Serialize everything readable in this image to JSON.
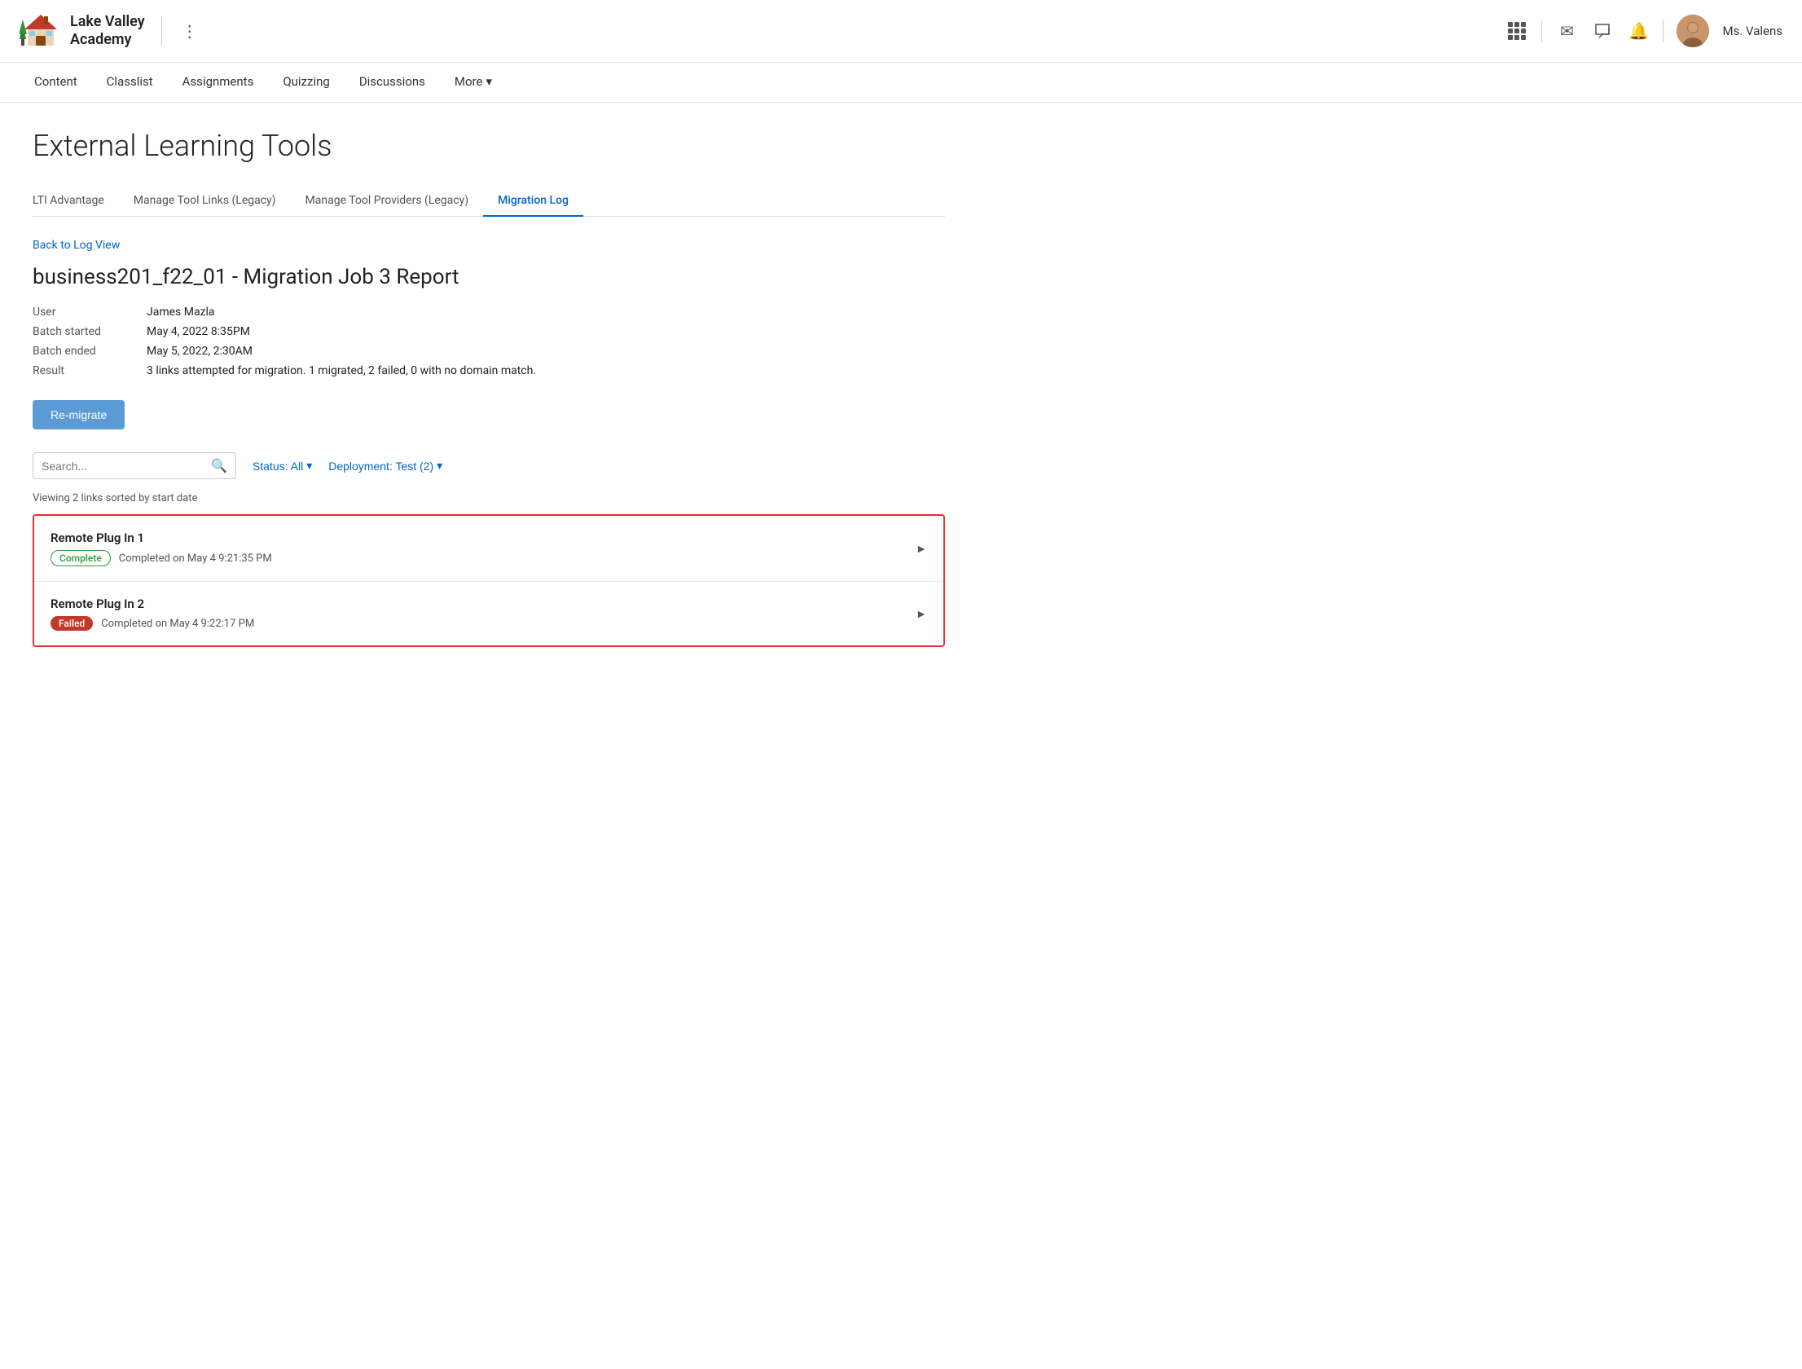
{
  "header": {
    "school_name_line1": "Lake Valley",
    "school_name_line2": "Academy",
    "user_name": "Ms. Valens",
    "icons": {
      "grid": "grid-icon",
      "mail": "✉",
      "chat": "💬",
      "bell": "🔔"
    }
  },
  "nav": {
    "items": [
      {
        "label": "Content",
        "active": false
      },
      {
        "label": "Classlist",
        "active": false
      },
      {
        "label": "Assignments",
        "active": false
      },
      {
        "label": "Quizzing",
        "active": false
      },
      {
        "label": "Discussions",
        "active": false
      },
      {
        "label": "More",
        "active": false,
        "has_dropdown": true
      }
    ]
  },
  "page": {
    "title": "External Learning Tools",
    "tabs": [
      {
        "label": "LTI Advantage",
        "active": false
      },
      {
        "label": "Manage Tool Links (Legacy)",
        "active": false
      },
      {
        "label": "Manage Tool Providers (Legacy)",
        "active": false
      },
      {
        "label": "Migration Log",
        "active": true
      }
    ],
    "back_link": "Back to Log View",
    "report": {
      "title": "business201_f22_01 - Migration Job 3 Report",
      "meta": [
        {
          "label": "User",
          "value": "James Mazla"
        },
        {
          "label": "Batch started",
          "value": "May 4, 2022 8:35PM"
        },
        {
          "label": "Batch ended",
          "value": "May 5, 2022, 2:30AM"
        },
        {
          "label": "Result",
          "value": "3 links attempted for migration. 1 migrated, 2 failed, 0 with no domain match."
        }
      ]
    },
    "remigrate_button": "Re-migrate",
    "search": {
      "placeholder": "Search..."
    },
    "filters": [
      {
        "label": "Status: All",
        "id": "status-filter"
      },
      {
        "label": "Deployment: Test (2)",
        "id": "deployment-filter"
      }
    ],
    "viewing_info": "Viewing 2 links sorted by start date",
    "results": [
      {
        "name": "Remote Plug In 1",
        "badge": "Complete",
        "badge_type": "complete",
        "meta": "Completed on May 4 9:21:35 PM"
      },
      {
        "name": "Remote Plug In 2",
        "badge": "Failed",
        "badge_type": "failed",
        "meta": "Completed on May 4 9:22:17 PM"
      }
    ]
  }
}
